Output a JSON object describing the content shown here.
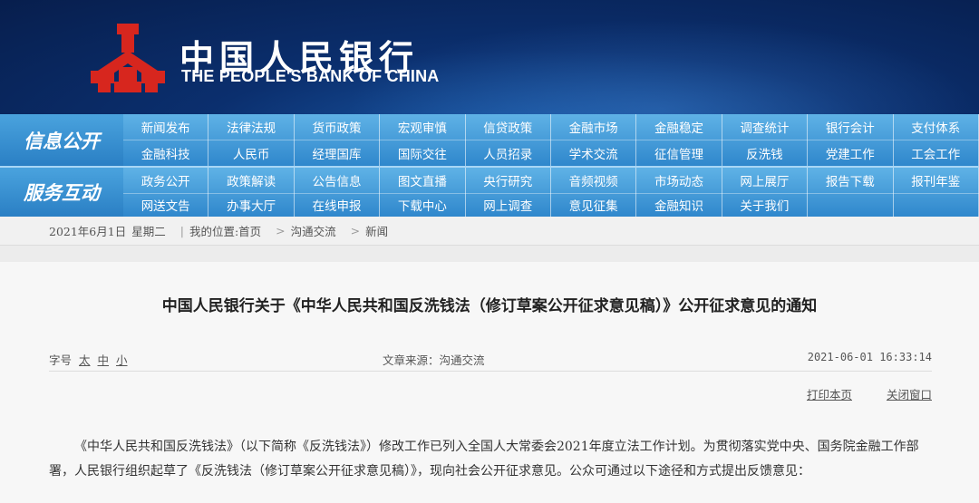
{
  "header": {
    "brand_cn": "中国人民银行",
    "brand_en": "THE PEOPLE'S BANK OF CHINA"
  },
  "nav_info": {
    "label": "信息公开",
    "items": [
      "新闻发布",
      "法律法规",
      "货币政策",
      "宏观审慎",
      "信贷政策",
      "金融市场",
      "金融稳定",
      "调查统计",
      "银行会计",
      "支付体系",
      "金融科技",
      "人民币",
      "经理国库",
      "国际交往",
      "人员招录",
      "学术交流",
      "征信管理",
      "反洗钱",
      "党建工作",
      "工会工作"
    ]
  },
  "nav_service": {
    "label": "服务互动",
    "items": [
      "政务公开",
      "政策解读",
      "公告信息",
      "图文直播",
      "央行研究",
      "音频视频",
      "市场动态",
      "网上展厅",
      "报告下载",
      "报刊年鉴",
      "网送文告",
      "办事大厅",
      "在线申报",
      "下载中心",
      "网上调查",
      "意见征集",
      "金融知识",
      "关于我们"
    ]
  },
  "breadcrumb": {
    "date": "2021年6月1日",
    "weekday": "星期二",
    "sep": "|",
    "location_label": "我的位置:首页",
    "arrow": ">",
    "level1": "沟通交流",
    "level2": "新闻"
  },
  "article": {
    "title": "中国人民银行关于《中华人民共和国反洗钱法（修订草案公开征求意见稿）》公开征求意见的通知",
    "font_label": "字号",
    "font_large": "太",
    "font_medium": "中",
    "font_small": "小",
    "source": "文章来源：沟通交流",
    "timestamp": "2021-06-01 16:33:14",
    "print_label": "打印本页",
    "close_label": "关闭窗口",
    "paragraph": "《中华人民共和国反洗钱法》（以下简称《反洗钱法》）修改工作已列入全国人大常委会2021年度立法工作计划。为贯彻落实党中央、国务院金融工作部署，人民银行组织起草了《反洗钱法（修订草案公开征求意见稿）》，现向社会公开征求意见。公众可通过以下途径和方式提出反馈意见："
  },
  "colors": {
    "header_dark": "#071e4d",
    "nav_blue": "#2f87cc",
    "logo_red": "#d7261e"
  }
}
